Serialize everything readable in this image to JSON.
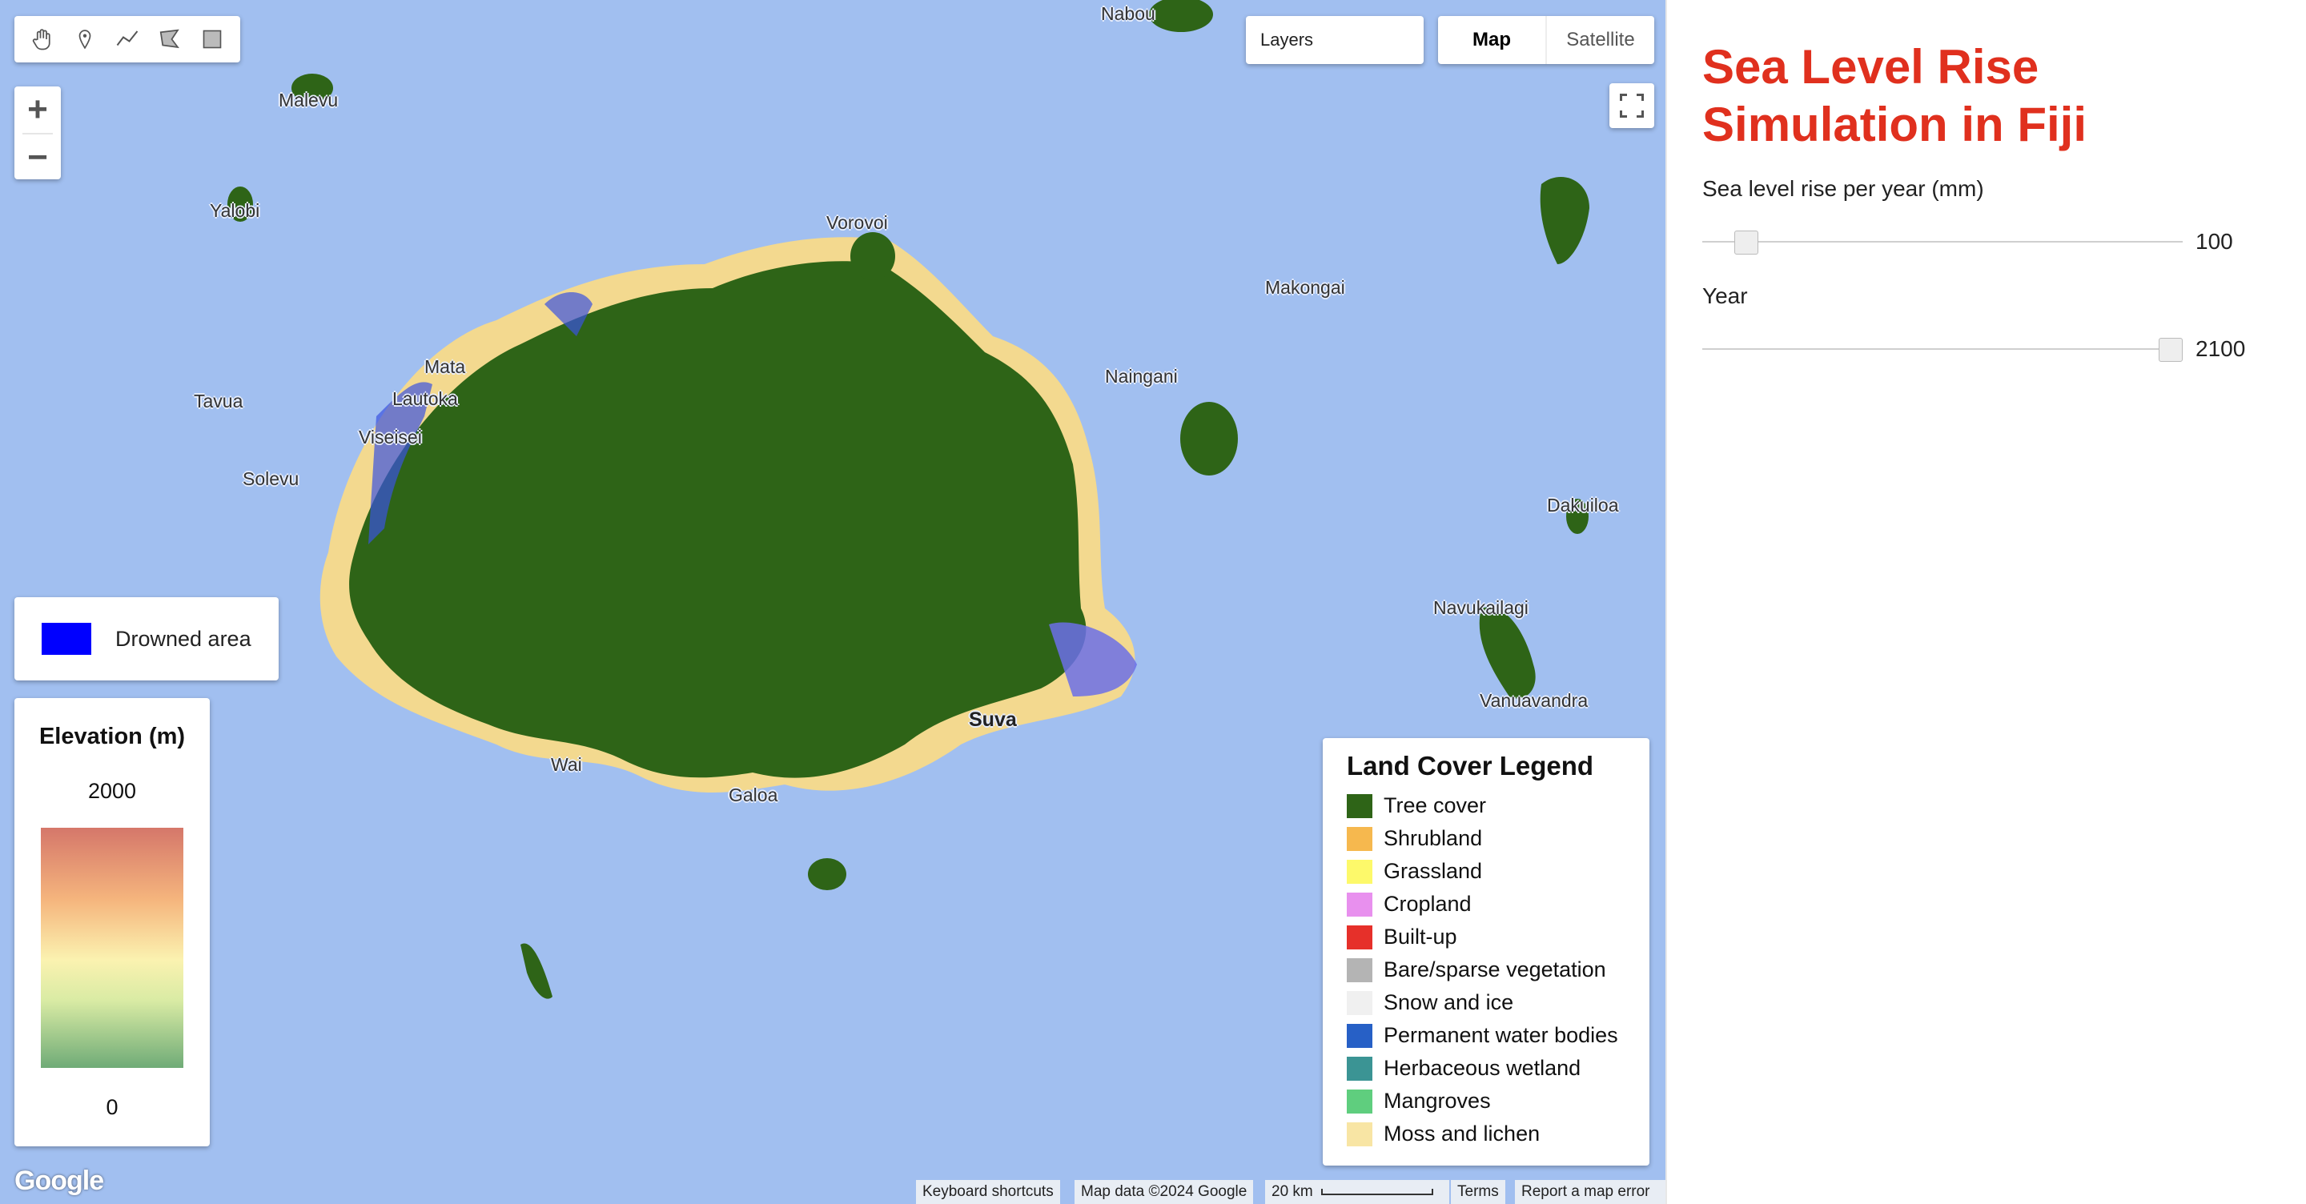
{
  "map": {
    "toolbar_tools": [
      "hand-icon",
      "marker-icon",
      "line-icon",
      "polygon-icon",
      "rectangle-icon"
    ],
    "zoom_in": "+",
    "zoom_out": "−",
    "layers_label": "Layers",
    "map_type": {
      "map": "Map",
      "satellite": "Satellite",
      "selected": "Map"
    },
    "places": [
      "Nabou",
      "Malevu",
      "Yalobi",
      "Vorovoi",
      "Makongai",
      "Naingani",
      "Tavua",
      "Solevu",
      "Viseisei",
      "Lautoka",
      "Mata",
      "Suva",
      "Wai",
      "Galoa",
      "Navukailagi",
      "Vanuavandra",
      "Dakuiloa"
    ],
    "drowned_area": {
      "label": "Drowned area",
      "color": "#0000ff"
    },
    "elevation": {
      "title": "Elevation (m)",
      "max": "2000",
      "min": "0"
    },
    "land_cover_legend": {
      "title": "Land Cover Legend",
      "items": [
        {
          "label": "Tree cover",
          "color": "#2e6417"
        },
        {
          "label": "Shrubland",
          "color": "#f6b84e"
        },
        {
          "label": "Grassland",
          "color": "#fdf96a"
        },
        {
          "label": "Cropland",
          "color": "#e890ee"
        },
        {
          "label": "Built-up",
          "color": "#e6302a"
        },
        {
          "label": "Bare/sparse vegetation",
          "color": "#b4b4b4"
        },
        {
          "label": "Snow and ice",
          "color": "#f0f0f0"
        },
        {
          "label": "Permanent water bodies",
          "color": "#2760c6"
        },
        {
          "label": "Herbaceous wetland",
          "color": "#3b9494"
        },
        {
          "label": "Mangroves",
          "color": "#5fce7e"
        },
        {
          "label": "Moss and lichen",
          "color": "#f8e5a4"
        }
      ]
    },
    "logo": "Google",
    "attribution": {
      "shortcuts": "Keyboard shortcuts",
      "data": "Map data ©2024 Google",
      "scale": "20 km",
      "terms": "Terms",
      "report": "Report a map error"
    }
  },
  "panel": {
    "title": "Sea Level Rise Simulation in Fiji",
    "rise_label": "Sea level rise per year (mm)",
    "rise_value": "100",
    "rise_fraction": 0.07,
    "year_label": "Year",
    "year_value": "2100",
    "year_fraction": 1.0
  }
}
